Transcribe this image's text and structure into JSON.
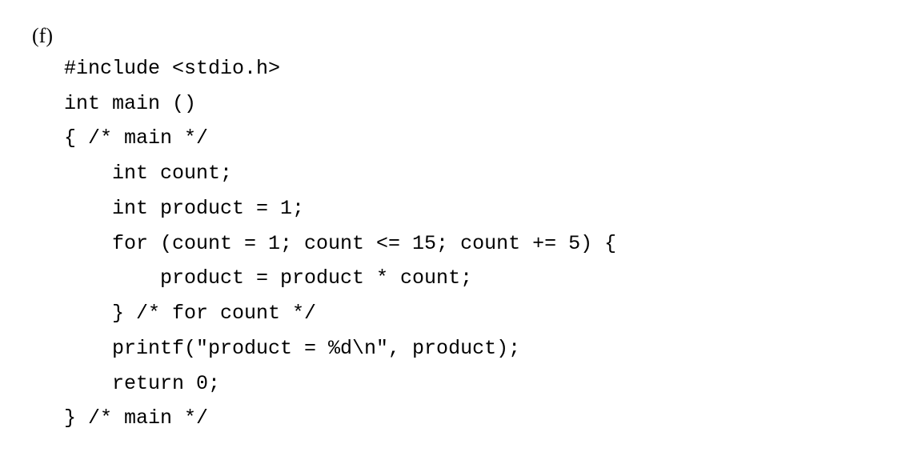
{
  "label": "(f)",
  "code": {
    "l1": "#include <stdio.h>",
    "l2": "int main ()",
    "l3": "{ /* main */",
    "l4": "    int count;",
    "l5": "    int product = 1;",
    "l6": "    for (count = 1; count <= 15; count += 5) {",
    "l7": "        product = product * count;",
    "l8": "    } /* for count */",
    "l9": "    printf(\"product = %d\\n\", product);",
    "l10": "    return 0;",
    "l11": "} /* main */"
  }
}
